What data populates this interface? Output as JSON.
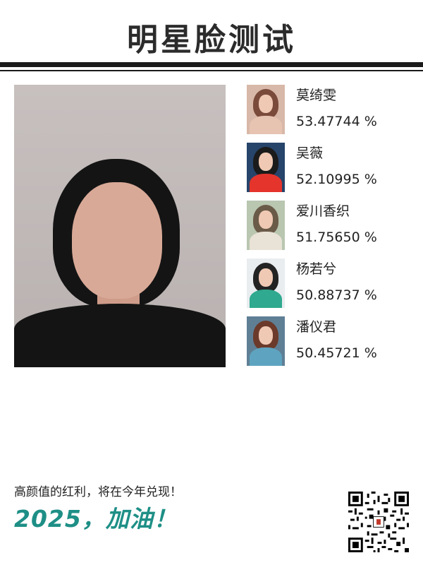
{
  "header": {
    "title": "明星脸测试"
  },
  "photo": {
    "subject": "selfie-photo"
  },
  "matches": [
    {
      "name": "莫绮雯",
      "score": "53.47744 %",
      "hair": "#7a4a3a",
      "bg": "#d8b8a8",
      "body": "#e7c3b1"
    },
    {
      "name": "吴薇",
      "score": "52.10995 %",
      "hair": "#1b1b1b",
      "bg": "#27446a",
      "body": "#e4342c"
    },
    {
      "name": "爱川香织",
      "score": "51.75650 %",
      "hair": "#6a5a48",
      "bg": "#b9c6b0",
      "body": "#e9e2d6"
    },
    {
      "name": "杨若兮",
      "score": "50.88737 %",
      "hair": "#232323",
      "bg": "#e9edf0",
      "body": "#2fa98f"
    },
    {
      "name": "潘仪君",
      "score": "50.45721 %",
      "hair": "#6b3a2a",
      "bg": "#5f7f95",
      "body": "#5ea4c0"
    }
  ],
  "footer": {
    "slogan": "高颜值的红利，将在今年兑现！",
    "cheer": "2025，加油！",
    "qr_icon": "qr-code-icon"
  },
  "colors": {
    "accent": "#1e8f86",
    "title": "#2b2b2b"
  }
}
